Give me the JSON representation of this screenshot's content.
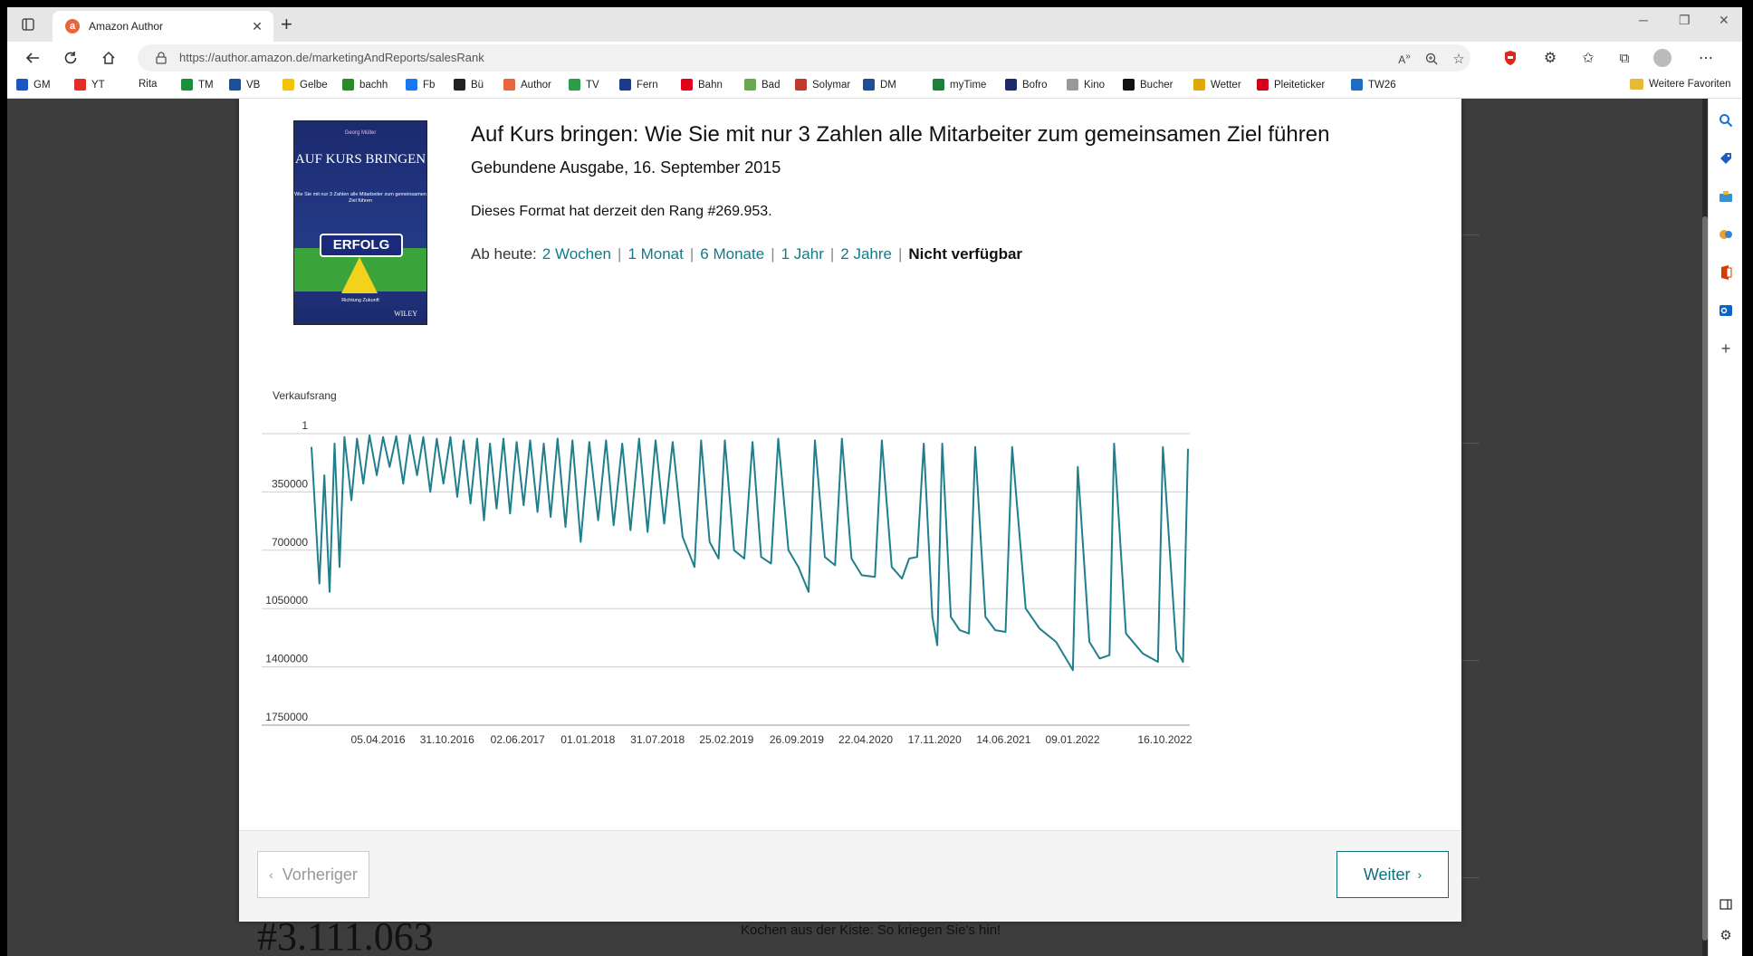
{
  "browser": {
    "tab_title": "Amazon Author",
    "url": "https://author.amazon.de/marketingAndReports/salesRank",
    "bookmarks": [
      {
        "label": "GM",
        "icon": "gm-icon",
        "color": "#1a56c4"
      },
      {
        "label": "YT",
        "icon": "youtube-icon",
        "color": "#e52d27"
      },
      {
        "label": "Rita",
        "icon": "",
        "color": ""
      },
      {
        "label": "TM",
        "icon": "t-icon",
        "color": "#1a8f3a"
      },
      {
        "label": "VB",
        "icon": "vb-icon",
        "color": "#1b4fa0"
      },
      {
        "label": "Gelbe",
        "icon": "gelbe-icon",
        "color": "#f5c400"
      },
      {
        "label": "bachh",
        "icon": "square-icon",
        "color": "#2a8a2a"
      },
      {
        "label": "Fb",
        "icon": "facebook-icon",
        "color": "#1877f2"
      },
      {
        "label": "Bü",
        "icon": "amazon-icon",
        "color": "#222"
      },
      {
        "label": "Author",
        "icon": "amazon-author-icon",
        "color": "#e8663e"
      },
      {
        "label": "TV",
        "icon": "heart-icon",
        "color": "#2a9d4a"
      },
      {
        "label": "Fern",
        "icon": "tv-icon",
        "color": "#1a3a8a"
      },
      {
        "label": "Bahn",
        "icon": "db-icon",
        "color": "#e2001a"
      },
      {
        "label": "Bad",
        "icon": "bad-icon",
        "color": "#6aa84f"
      },
      {
        "label": "Solymar",
        "icon": "s-icon",
        "color": "#c0392b"
      },
      {
        "label": "DM",
        "icon": "dm-icon",
        "color": "#1f4e99"
      },
      {
        "label": "myTime",
        "icon": "mytime-icon",
        "color": "#1e7f3c"
      },
      {
        "label": "Bofro",
        "icon": "star-icon",
        "color": "#1b2a6b"
      },
      {
        "label": "Kino",
        "icon": "kino-icon",
        "color": "#999"
      },
      {
        "label": "Bucher",
        "icon": "bucher-icon",
        "color": "#111"
      },
      {
        "label": "Wetter",
        "icon": "wetter-icon",
        "color": "#e0a800"
      },
      {
        "label": "Pleiteticker",
        "icon": "pleite-icon",
        "color": "#d4001a"
      },
      {
        "label": "TW26",
        "icon": "tw26-icon",
        "color": "#1a6fc0"
      }
    ],
    "favorites_label": "Weitere Favoriten"
  },
  "book": {
    "title": "Auf Kurs bringen: Wie Sie mit nur 3 Zahlen alle Mitarbeiter zum gemeinsamen Ziel führen",
    "format": "Gebundene Ausgabe, 16. September 2015",
    "rank_text": "Dieses Format hat derzeit den Rang #269.953.",
    "cover": {
      "author": "Georg Müller",
      "title": "AUF KURS BRINGEN",
      "subtitle": "Wie Sie mit nur 3 Zahlen alle Mitarbeiter zum gemeinsamen Ziel führen",
      "sign": "ERFOLG",
      "bottom": "Richtung Zukunft",
      "publisher": "WILEY"
    }
  },
  "ranges": {
    "label": "Ab heute:",
    "items": [
      "2 Wochen",
      "1 Monat",
      "6 Monate",
      "1 Jahr",
      "2 Jahre"
    ],
    "selected": "Nicht verfügbar"
  },
  "chart_data": {
    "type": "line",
    "ylabel": "Verkaufsrang",
    "y_inverted": true,
    "ylim": [
      1,
      1750000
    ],
    "yticks": [
      "1",
      "350000",
      "700000",
      "1050000",
      "1400000",
      "1750000"
    ],
    "xticks": [
      "05.04.2016",
      "31.10.2016",
      "02.06.2017",
      "01.01.2018",
      "31.07.2018",
      "25.02.2019",
      "26.09.2019",
      "22.04.2020",
      "17.11.2020",
      "14.06.2021",
      "09.01.2022",
      "16.10.2022"
    ],
    "color": "#1f7f8c",
    "series": [
      {
        "name": "",
        "points": [
          [
            "2015-09-16",
            80000
          ],
          [
            "2015-10-10",
            900000
          ],
          [
            "2015-10-25",
            250000
          ],
          [
            "2015-11-10",
            950000
          ],
          [
            "2015-11-25",
            60000
          ],
          [
            "2015-12-10",
            800000
          ],
          [
            "2015-12-25",
            20000
          ],
          [
            "2016-01-15",
            400000
          ],
          [
            "2016-02-01",
            30000
          ],
          [
            "2016-02-20",
            300000
          ],
          [
            "2016-03-10",
            10000
          ],
          [
            "2016-04-01",
            250000
          ],
          [
            "2016-04-20",
            20000
          ],
          [
            "2016-05-10",
            200000
          ],
          [
            "2016-05-30",
            15000
          ],
          [
            "2016-06-20",
            300000
          ],
          [
            "2016-07-10",
            10000
          ],
          [
            "2016-08-01",
            250000
          ],
          [
            "2016-08-20",
            20000
          ],
          [
            "2016-09-10",
            350000
          ],
          [
            "2016-09-30",
            30000
          ],
          [
            "2016-10-20",
            300000
          ],
          [
            "2016-11-10",
            20000
          ],
          [
            "2016-12-01",
            380000
          ],
          [
            "2016-12-20",
            40000
          ],
          [
            "2017-01-10",
            420000
          ],
          [
            "2017-01-30",
            30000
          ],
          [
            "2017-02-20",
            520000
          ],
          [
            "2017-03-10",
            60000
          ],
          [
            "2017-03-30",
            450000
          ],
          [
            "2017-04-20",
            30000
          ],
          [
            "2017-05-10",
            480000
          ],
          [
            "2017-05-30",
            50000
          ],
          [
            "2017-06-20",
            430000
          ],
          [
            "2017-07-10",
            40000
          ],
          [
            "2017-08-01",
            470000
          ],
          [
            "2017-08-20",
            60000
          ],
          [
            "2017-09-10",
            500000
          ],
          [
            "2017-10-01",
            30000
          ],
          [
            "2017-10-25",
            560000
          ],
          [
            "2017-11-15",
            40000
          ],
          [
            "2017-12-10",
            650000
          ],
          [
            "2018-01-05",
            50000
          ],
          [
            "2018-02-01",
            520000
          ],
          [
            "2018-02-25",
            40000
          ],
          [
            "2018-03-20",
            550000
          ],
          [
            "2018-04-15",
            60000
          ],
          [
            "2018-05-10",
            580000
          ],
          [
            "2018-06-05",
            30000
          ],
          [
            "2018-07-01",
            590000
          ],
          [
            "2018-07-25",
            40000
          ],
          [
            "2018-08-20",
            540000
          ],
          [
            "2018-09-15",
            50000
          ],
          [
            "2018-10-15",
            620000
          ],
          [
            "2018-11-20",
            800000
          ],
          [
            "2018-12-10",
            40000
          ],
          [
            "2019-01-05",
            650000
          ],
          [
            "2019-02-01",
            750000
          ],
          [
            "2019-02-20",
            40000
          ],
          [
            "2019-03-20",
            700000
          ],
          [
            "2019-04-20",
            750000
          ],
          [
            "2019-05-15",
            50000
          ],
          [
            "2019-06-10",
            740000
          ],
          [
            "2019-07-10",
            780000
          ],
          [
            "2019-08-01",
            30000
          ],
          [
            "2019-09-01",
            700000
          ],
          [
            "2019-10-01",
            800000
          ],
          [
            "2019-11-01",
            950000
          ],
          [
            "2019-11-20",
            40000
          ],
          [
            "2019-12-20",
            740000
          ],
          [
            "2020-01-20",
            790000
          ],
          [
            "2020-02-10",
            30000
          ],
          [
            "2020-03-10",
            750000
          ],
          [
            "2020-04-10",
            850000
          ],
          [
            "2020-05-20",
            860000
          ],
          [
            "2020-06-10",
            40000
          ],
          [
            "2020-07-10",
            800000
          ],
          [
            "2020-08-10",
            870000
          ],
          [
            "2020-09-01",
            750000
          ],
          [
            "2020-09-25",
            740000
          ],
          [
            "2020-10-15",
            60000
          ],
          [
            "2020-11-10",
            1100000
          ],
          [
            "2020-11-25",
            1270000
          ],
          [
            "2020-12-10",
            60000
          ],
          [
            "2021-01-05",
            1100000
          ],
          [
            "2021-02-01",
            1180000
          ],
          [
            "2021-03-01",
            1200000
          ],
          [
            "2021-03-20",
            80000
          ],
          [
            "2021-04-20",
            1100000
          ],
          [
            "2021-05-20",
            1180000
          ],
          [
            "2021-06-20",
            1190000
          ],
          [
            "2021-07-10",
            80000
          ],
          [
            "2021-08-20",
            1050000
          ],
          [
            "2021-10-01",
            1170000
          ],
          [
            "2021-11-20",
            1250000
          ],
          [
            "2022-01-10",
            1420000
          ],
          [
            "2022-01-25",
            200000
          ],
          [
            "2022-03-01",
            1250000
          ],
          [
            "2022-04-01",
            1350000
          ],
          [
            "2022-05-01",
            1330000
          ],
          [
            "2022-05-15",
            60000
          ],
          [
            "2022-06-20",
            1200000
          ],
          [
            "2022-08-10",
            1320000
          ],
          [
            "2022-09-25",
            1370000
          ],
          [
            "2022-10-10",
            80000
          ],
          [
            "2022-11-20",
            1300000
          ],
          [
            "2022-12-10",
            1370000
          ],
          [
            "2022-12-25",
            90000
          ]
        ]
      }
    ]
  },
  "footer": {
    "prev_label": "Vorheriger",
    "next_label": "Weiter"
  },
  "background": {
    "rank": "#3.111.063",
    "text": "Kochen aus der Kiste: So kriegen Sie's hin!"
  }
}
